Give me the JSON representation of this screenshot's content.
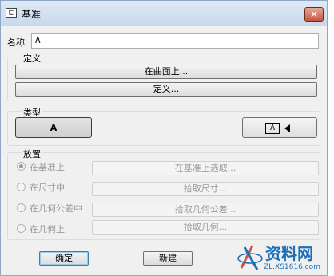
{
  "window": {
    "title": "基准",
    "icon_text": "⊑",
    "close_label": "✕"
  },
  "name": {
    "label": "名称",
    "value": "A"
  },
  "definition": {
    "group_title": "定义",
    "on_surface_button": "在曲面上...",
    "define_button": "定义..."
  },
  "type": {
    "group_title": "类型",
    "option_a_label": "A",
    "option_b_label": "A"
  },
  "placement": {
    "group_title": "放置",
    "options": [
      {
        "label": "在基准上",
        "button": "在基准上选取...",
        "checked": true
      },
      {
        "label": "在尺寸中",
        "button": "拾取尺寸...",
        "checked": false
      },
      {
        "label": "在几何公差中",
        "button": "拾取几何公差...",
        "checked": false
      },
      {
        "label": "在几何上",
        "button": "拾取几何...",
        "checked": false
      }
    ]
  },
  "footer": {
    "ok_button": "确定",
    "new_button": "新建"
  },
  "watermark": {
    "text": "资料网",
    "url": "ZL.XS1616.com"
  },
  "colors": {
    "titlebar": "#c7d8ee",
    "close_button": "#c9563c",
    "dialog_bg": "#f0f0f0",
    "watermark": "#1c6fb8"
  }
}
